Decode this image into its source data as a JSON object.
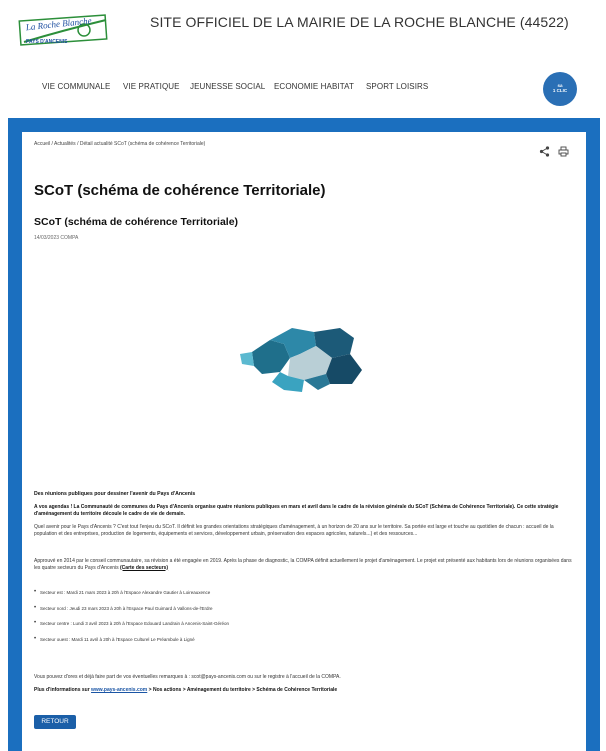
{
  "header": {
    "title": "SITE OFFICIEL DE LA MAIRIE DE LA ROCHE BLANCHE (44522)",
    "logo_text_top": "La Roche Blanche",
    "logo_text_bottom": "PAYS D'ANCENIS"
  },
  "nav": {
    "items": [
      "VIE COMMUNALE",
      "VIE PRATIQUE",
      "JEUNESSE SOCIAL",
      "ECONOMIE HABITAT",
      "SPORT LOISIRS"
    ],
    "date_badge": [
      "sa",
      "1 CLIC"
    ]
  },
  "article": {
    "breadcrumb": "Accueil / Actualités / Détail actualité SCoT (schéma de cohérence Territoriale)",
    "title": "SCoT (schéma de cohérence Territoriale)",
    "subtitle": "SCoT (schéma de cohérence Territoriale)",
    "meta": "14/03/2023 COMPA",
    "section_heading": "Des réunions publiques pour dessiner l'avenir du Pays d'Ancenis",
    "intro_bold": "A vos agendas ! La Communauté de communes du Pays d'Ancenis organise quatre réunions publiques en mars et avril dans le cadre de la révision générale du SCoT (Schéma de Cohérence Territoriale). Ce cette stratégie d'aménagement du territoire découle le cadre de vie de demain.",
    "para1": "Quel avenir pour le Pays d'Ancenis ? C'est tout l'enjeu du SCoT. Il définit les grandes orientations stratégiques d'aménagement, à un horizon de 20 ans sur le territoire. Sa portée est large et touche au quotidien de chacun : accueil de la population et des entreprises, production de logements, équipements et services, développement urbain, préservation des espaces agricoles, naturels...) et des ressources...",
    "para2_start": "Approuvé en 2014 par le conseil communautaire, sa révision a été engagée en 2019. Après la phase de diagnostic, la COMPA définit actuellement le projet d'aménagement. Le projet est présenté aux habitants lors de réunions organisées dans les quatre secteurs du Pays d'Ancenis",
    "para2_link": "(Carte des secteurs)",
    "meetings": [
      "Secteur est : Mardi 21 mars 2023 à 20h à l'Espace Alexandre Gautier à Loireauxence",
      "Secteur nord : Jeudi 23 mars 2023 à 20h à l'Espace Paul Guimard à Vallons-de-l'Erdre",
      "Secteur centre : Lundi 3 avril 2023 à 20h à l'Espace Edouard Landrain à Ancenis-Saint-Géréon",
      "Secteur ouest : Mardi 11 avril à 20h à l'Espace Culturel Le Préambule à Ligné"
    ],
    "para3": "Vous pouvez d'ores et déjà faire part de vos éventuelles remarques à : scot@pays-ancenis.com ou sur le registre à l'accueil de la COMPA.",
    "more_info_start": "Plus d'informations sur",
    "more_info_link": "www.pays-ancenis.com",
    "more_info_end": "> Nos actions > Aménagement du territoire > Schéma de Cohérence Territoriale",
    "back_label": "RETOUR"
  },
  "colors": {
    "accent": "#1b6fbf",
    "button": "#1b5fa8",
    "badge": "#2a6fb5"
  }
}
